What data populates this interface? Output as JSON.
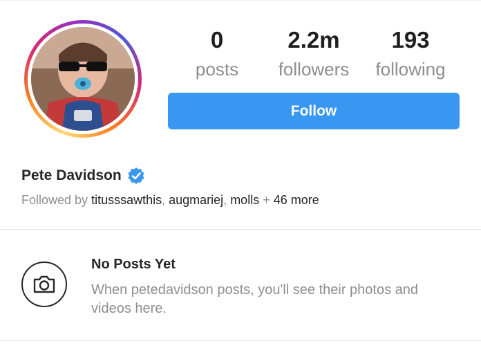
{
  "profile": {
    "name": "Pete Davidson",
    "verified": true,
    "avatar": "avatar-photo"
  },
  "stats": {
    "posts": {
      "value": "0",
      "label": "posts"
    },
    "followers": {
      "value": "2.2m",
      "label": "followers"
    },
    "following": {
      "value": "193",
      "label": "following"
    }
  },
  "actions": {
    "follow_label": "Follow"
  },
  "followed_by": {
    "prefix": "Followed by ",
    "users": [
      "titusssawthis",
      "augmariej",
      "molls"
    ],
    "separator": ", ",
    "plus": " + ",
    "more": "46 more"
  },
  "empty_state": {
    "icon": "camera-icon",
    "title": "No Posts Yet",
    "body": "When petedavidson posts, you'll see their photos and videos here."
  },
  "colors": {
    "follow_button": "#3897f0",
    "verified_badge": "#3897f0",
    "muted_text": "#8e8e8e"
  }
}
